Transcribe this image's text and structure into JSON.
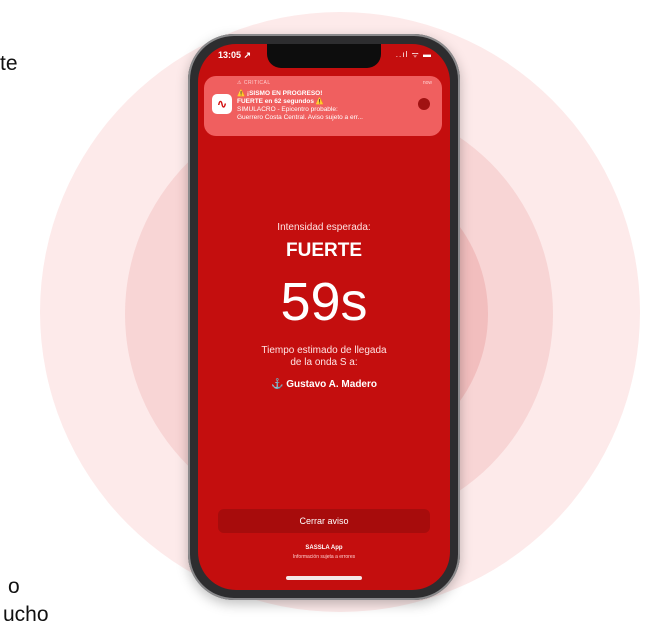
{
  "side_text": [
    "te",
    "o",
    "ucho"
  ],
  "status_bar": {
    "time": "13:05 ↗",
    "icons": "..ıl ᯤ ▬"
  },
  "notification": {
    "header": "⚠ CRITICAL",
    "time": "now",
    "app_icon_glyph": "∿",
    "line1": "⚠️ ¡SISMO EN PROGRESO!",
    "line2": "FUERTE en 62 segundos ⚠️",
    "line3": "SIMULACRO - Epicentro probable:",
    "line4": "Guerrero Costa Central. Aviso sujeto a err..."
  },
  "alert": {
    "intensity_label": "Intensidad esperada:",
    "intensity_value": "FUERTE",
    "countdown": "59s",
    "eta_line1": "Tiempo estimado de llegada",
    "eta_line2": "de la onda S a:",
    "location": "⚓ Gustavo A. Madero"
  },
  "footer": {
    "close_button": "Cerrar aviso",
    "app_name": "SASSLA App",
    "disclaimer": "Información sujeta a errores"
  },
  "colors": {
    "screen_bg": "#c40e0e",
    "notification_bg": "#f05f5f",
    "button_bg": "#a70c0c"
  }
}
